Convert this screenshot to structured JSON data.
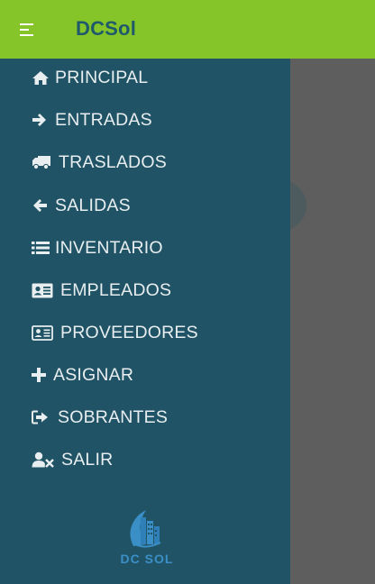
{
  "app": {
    "title": "DCSol"
  },
  "menu": {
    "items": [
      {
        "label": "PRINCIPAL",
        "icon": "home-icon"
      },
      {
        "label": "ENTRADAS",
        "icon": "arrow-right-icon"
      },
      {
        "label": "TRASLADOS",
        "icon": "truck-icon"
      },
      {
        "label": "SALIDAS",
        "icon": "arrow-left-icon"
      },
      {
        "label": "INVENTARIO",
        "icon": "list-icon"
      },
      {
        "label": "EMPLEADOS",
        "icon": "id-card-icon"
      },
      {
        "label": "PROVEEDORES",
        "icon": "id-card-outline-icon"
      },
      {
        "label": "ASIGNAR",
        "icon": "plus-icon"
      },
      {
        "label": "SOBRANTES",
        "icon": "sign-out-icon"
      },
      {
        "label": "SALIR",
        "icon": "user-times-icon"
      }
    ]
  },
  "logo": {
    "text": "DC SOL"
  },
  "colors": {
    "topbar": "#86c529",
    "drawer": "#205365",
    "title": "#1f5a6b",
    "menu_text": "#e8eef0",
    "logo": "#3b8fc7"
  }
}
